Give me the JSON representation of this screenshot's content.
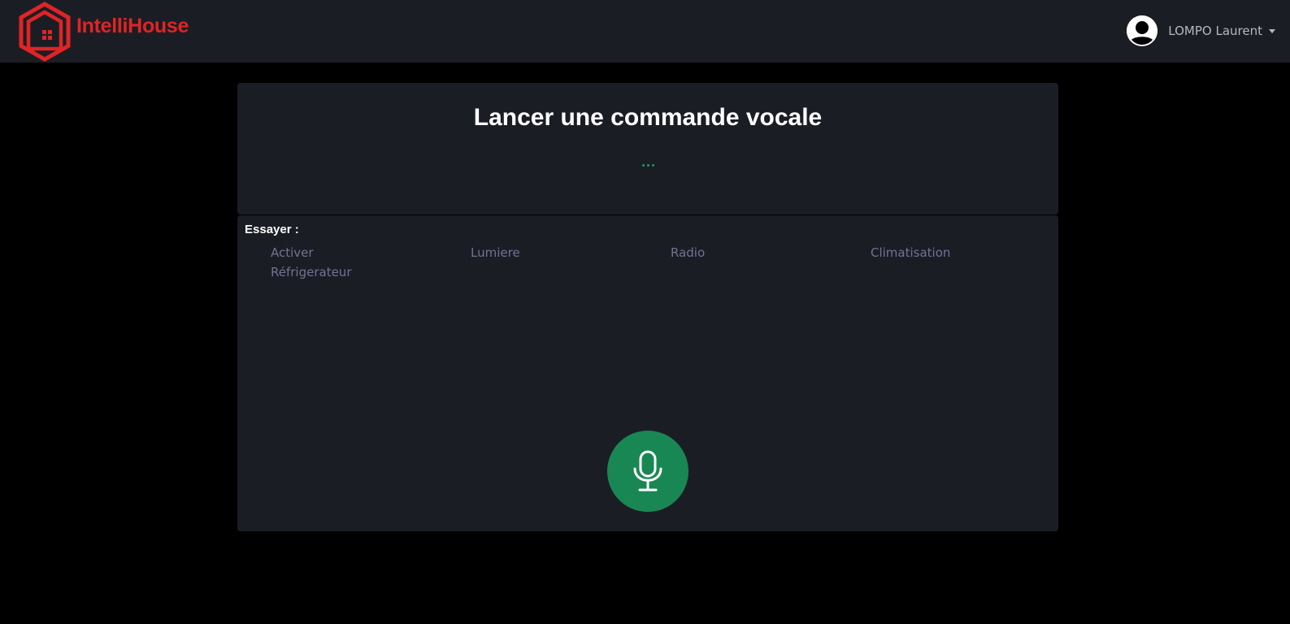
{
  "navbar": {
    "brand_name": "IntelliHouse",
    "brand_color": "#e02424",
    "logo_icon": "house-hexagon-icon",
    "user": {
      "name": "LOMPO Laurent",
      "avatar_icon": "user-avatar-icon",
      "dropdown_icon": "caret-down-icon"
    }
  },
  "voice": {
    "title": "Lancer une commande vocale",
    "status_icon": "listening-dots-icon",
    "status_color": "#1d9b5c"
  },
  "try_section": {
    "label": "Essayer :",
    "suggestions": [
      "Activer",
      "Lumiere",
      "Radio",
      "Climatisation",
      "Réfrigerateur"
    ]
  },
  "mic": {
    "icon": "microphone-icon",
    "color": "#198754"
  }
}
